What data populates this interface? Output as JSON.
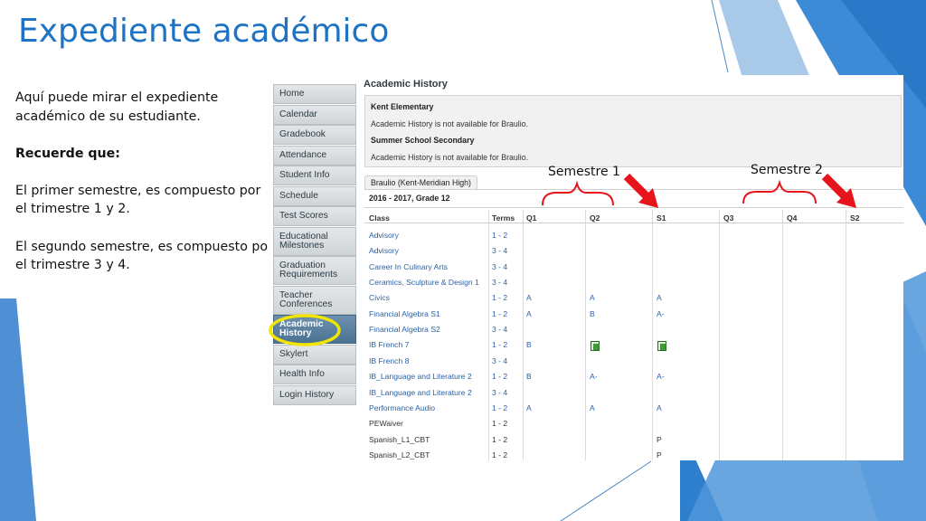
{
  "slide": {
    "title": "Expediente académico",
    "intro": "Aquí puede mirar el expediente académico de su estudiante.",
    "remember": "Recuerde que:",
    "first_semester": "El primer semestre, es compuesto por el trimestre 1 y 2.",
    "second_semester": "El segundo semestre, es compuesto por el trimestre 3 y 4."
  },
  "annotations": {
    "semester1": "Semestre 1",
    "semester2": "Semestre 2",
    "arrow_color": "#e8141c",
    "highlight_color": "#f2e600"
  },
  "colors": {
    "title": "#1f73c4",
    "link": "#2a62a8",
    "nav_active": "#4f7594"
  },
  "sidebar": {
    "items": [
      {
        "label": "Home"
      },
      {
        "label": "Calendar"
      },
      {
        "label": "Gradebook"
      },
      {
        "label": "Attendance"
      },
      {
        "label": "Student Info"
      },
      {
        "label": "Schedule"
      },
      {
        "label": "Test Scores"
      },
      {
        "label": "Educational Milestones"
      },
      {
        "label": "Graduation Requirements"
      },
      {
        "label": "Teacher Conferences"
      },
      {
        "label": "Academic History"
      },
      {
        "label": "Skylert"
      },
      {
        "label": "Health Info"
      },
      {
        "label": "Login History"
      }
    ]
  },
  "panel": {
    "title": "Academic History",
    "schools": [
      {
        "name": "Kent Elementary",
        "message": "Academic History is not available for Braulio."
      },
      {
        "name": "Summer School Secondary",
        "message": "Academic History is not available for Braulio."
      }
    ],
    "student_tab": "Braulio (Kent-Meridian High)",
    "year": "2016 - 2017, Grade 12"
  },
  "table": {
    "headers": [
      "Class",
      "Terms",
      "Q1",
      "Q2",
      "S1",
      "Q3",
      "Q4",
      "S2"
    ],
    "rows": [
      {
        "cls": "Advisory",
        "terms": "1 - 2",
        "q1": "",
        "q2": "",
        "s1": "",
        "link": true
      },
      {
        "cls": "Advisory",
        "terms": "3 - 4",
        "q1": "",
        "q2": "",
        "s1": "",
        "link": true
      },
      {
        "cls": "Career In Culinary Arts",
        "terms": "3 - 4",
        "q1": "",
        "q2": "",
        "s1": "",
        "link": true
      },
      {
        "cls": "Ceramics, Sculpture & Design 1",
        "terms": "3 - 4",
        "q1": "",
        "q2": "",
        "s1": "",
        "link": true
      },
      {
        "cls": "Civics",
        "terms": "1 - 2",
        "q1": "A",
        "q2": "A",
        "s1": "A",
        "link": true
      },
      {
        "cls": "Financial Algebra S1",
        "terms": "1 - 2",
        "q1": "A",
        "q2": "B",
        "s1": "A-",
        "link": true
      },
      {
        "cls": "Financial Algebra S2",
        "terms": "3 - 4",
        "q1": "",
        "q2": "",
        "s1": "",
        "link": true
      },
      {
        "cls": "IB French 7",
        "terms": "1 - 2",
        "q1": "B",
        "q2": "note-icon",
        "s1": "note-icon",
        "link": true
      },
      {
        "cls": "IB French 8",
        "terms": "3 - 4",
        "q1": "",
        "q2": "",
        "s1": "",
        "link": true
      },
      {
        "cls": "IB_Language and Literature 2",
        "terms": "1 - 2",
        "q1": "B",
        "q2": "A-",
        "s1": "A-",
        "link": true
      },
      {
        "cls": "IB_Language and Literature 2",
        "terms": "3 - 4",
        "q1": "",
        "q2": "",
        "s1": "",
        "link": true
      },
      {
        "cls": "Performance Audio",
        "terms": "1 - 2",
        "q1": "A",
        "q2": "A",
        "s1": "A",
        "link": true
      },
      {
        "cls": "PEWaiver",
        "terms": "1 - 2",
        "q1": "",
        "q2": "",
        "s1": "",
        "link": false
      },
      {
        "cls": "Spanish_L1_CBT",
        "terms": "1 - 2",
        "q1": "",
        "q2": "",
        "s1": "P",
        "link": false
      },
      {
        "cls": "Spanish_L2_CBT",
        "terms": "1 - 2",
        "q1": "",
        "q2": "",
        "s1": "P",
        "link": false
      }
    ]
  }
}
